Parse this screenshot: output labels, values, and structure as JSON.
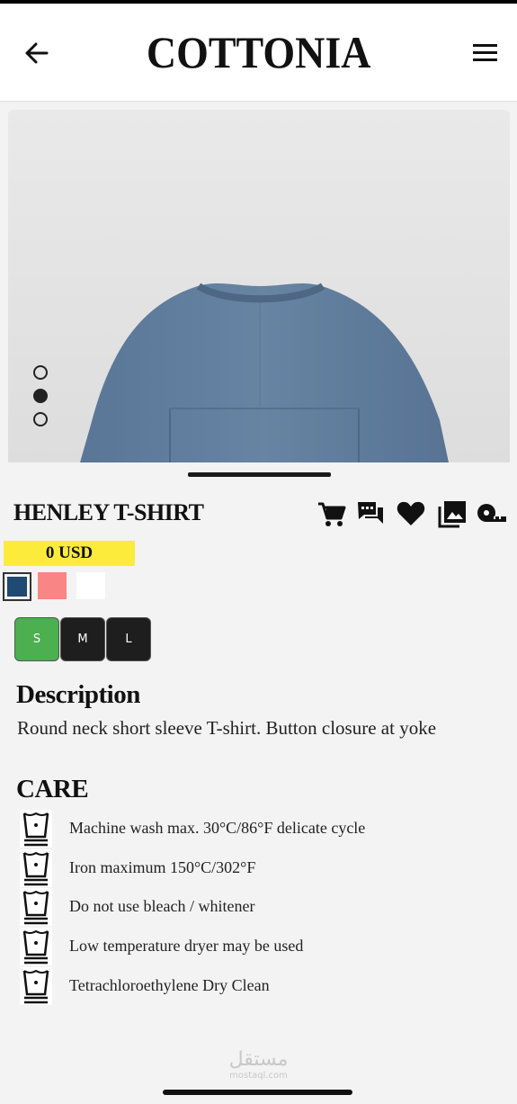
{
  "header": {
    "brand": "COTTONIA",
    "back_icon": "arrow-left-icon",
    "menu_icon": "hamburger-menu-icon"
  },
  "gallery": {
    "image": "blue-tshirt-photo",
    "dots": [
      {
        "active": false
      },
      {
        "active": true
      },
      {
        "active": false
      }
    ]
  },
  "product": {
    "title": "HENLEY T-SHIRT",
    "price": "0 USD",
    "actions": [
      "cart-icon",
      "chat-icon",
      "heart-icon",
      "gallery-icon",
      "measuring-tape-icon"
    ],
    "colors": [
      {
        "hex": "#1f4a72",
        "selected": true
      },
      {
        "hex": "#f98585",
        "selected": false
      },
      {
        "hex": "#ffffff",
        "selected": false
      }
    ],
    "sizes": [
      {
        "label": "S",
        "selected": true,
        "color": "#4caf50"
      },
      {
        "label": "M",
        "selected": false,
        "color": "#1e1e1e"
      },
      {
        "label": "L",
        "selected": false,
        "color": "#1e1e1e"
      }
    ]
  },
  "description": {
    "heading": "Description",
    "text": "Round neck short sleeve T-shirt. Button closure at yoke"
  },
  "care": {
    "heading": "CARE",
    "items": [
      {
        "icon": "wash-tub-icon",
        "text": "Machine wash max. 30°C/86°F delicate cycle"
      },
      {
        "icon": "wash-tub-icon",
        "text": "Iron maximum 150°C/302°F"
      },
      {
        "icon": "wash-tub-icon",
        "text": "Do not use bleach / whitener"
      },
      {
        "icon": "wash-tub-icon",
        "text": "Low temperature dryer may be used"
      },
      {
        "icon": "wash-tub-icon",
        "text": "Tetrachloroethylene Dry Clean"
      }
    ]
  },
  "watermark": {
    "arabic": "مستقل",
    "latin": "mostaql.com"
  }
}
